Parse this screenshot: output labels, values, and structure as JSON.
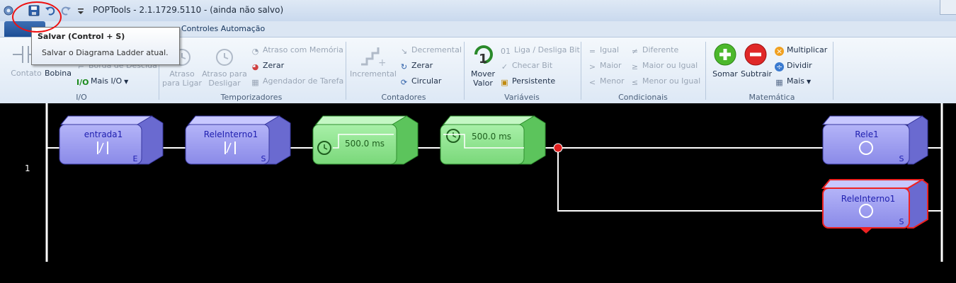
{
  "window": {
    "title": "POPTools - 2.1.1729.5110 - (ainda não salvo)"
  },
  "quick_access": {
    "items": [
      "app-icon",
      "save-icon",
      "undo-icon",
      "redo-icon",
      "customize-dropdown-icon"
    ]
  },
  "tabs": {
    "active": "Controles Automação"
  },
  "tooltip": {
    "title": "Salvar (Control + S)",
    "description": "Salvar o Diagrama Ladder atual."
  },
  "ribbon": {
    "io": {
      "label": "I/O",
      "contato": "Contato",
      "bobina": "Bobina",
      "borda_descida": "Borda de Descida",
      "mais_io": "Mais I/O"
    },
    "temporizadores": {
      "label": "Temporizadores",
      "atraso_ligar": [
        "Atraso",
        "para Ligar"
      ],
      "atraso_desligar": [
        "Atraso para",
        "Desligar"
      ],
      "atraso_memoria": "Atraso com Memória",
      "zerar": "Zerar",
      "agendador": "Agendador de Tarefa"
    },
    "contadores": {
      "label": "Contadores",
      "incremental": "Incremental",
      "decremental": "Decremental",
      "zerar": "Zerar",
      "circular": "Circular"
    },
    "variaveis": {
      "label": "Variáveis",
      "mover_valor": [
        "Mover",
        "Valor"
      ],
      "liga_desliga": "Liga / Desliga Bit",
      "checar_bit": "Checar Bit",
      "persistente": "Persistente"
    },
    "condicionais": {
      "label": "Condicionais",
      "igual": "Igual",
      "maior": "Maior",
      "menor": "Menor",
      "diferente": "Diferente",
      "maior_igual": "Maior ou Igual",
      "menor_igual": "Menor ou Igual"
    },
    "matematica": {
      "label": "Matemática",
      "somar": "Somar",
      "subtrair": "Subtrair",
      "multiplicar": "Multiplicar",
      "dividir": "Dividir",
      "mais": "Mais"
    }
  },
  "ladder": {
    "rung_number": "1",
    "blocks": {
      "entrada1": {
        "name": "entrada1",
        "type": "E"
      },
      "rele_interno_contact": {
        "name": "ReleInterno1",
        "type": "S"
      },
      "timer_on": {
        "value": "500.0 ms"
      },
      "timer_off": {
        "value": "500.0 ms"
      },
      "rele1": {
        "name": "Rele1",
        "type": "S"
      },
      "rele_interno_coil": {
        "name": "ReleInterno1",
        "type": "S"
      }
    },
    "colors": {
      "block_blue": "#9c9cf0",
      "block_green": "#90e890",
      "selected_border": "#ee2222",
      "wire": "#ffffff",
      "node": "#e02020"
    }
  }
}
